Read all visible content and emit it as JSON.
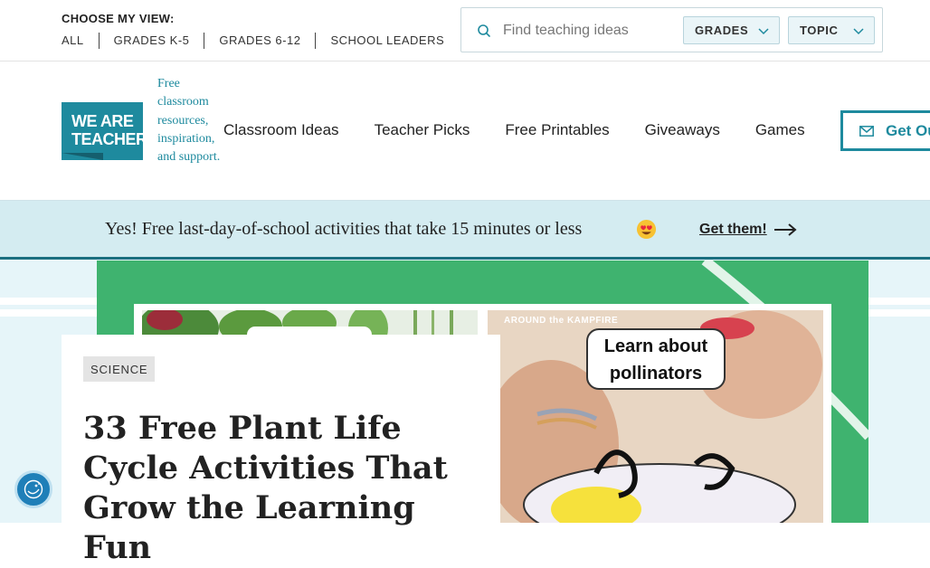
{
  "topbar": {
    "view_title": "CHOOSE MY VIEW:",
    "view_links": [
      "ALL",
      "GRADES K-5",
      "GRADES 6-12",
      "SCHOOL LEADERS"
    ],
    "search_placeholder": "Find teaching ideas",
    "filters": [
      "GRADES",
      "TOPIC"
    ]
  },
  "header": {
    "logo_text": "WE ARE TEACHERS",
    "tagline": "Free classroom resources, inspiration, and support.",
    "nav": [
      "Classroom Ideas",
      "Teacher Picks",
      "Free Printables",
      "Giveaways",
      "Games"
    ],
    "cta_label": "Get Ou"
  },
  "banner": {
    "text": "Yes! Free last-day-of-school activities that take 15 minutes or less",
    "link_label": "Get them!",
    "bg_color": "#d4ecf1"
  },
  "hero": {
    "photo_brand": "AROUND the KAMPFIRE",
    "photo_caption": "Learn about pollinators",
    "accent_color": "#3fb36f"
  },
  "article": {
    "category": "SCIENCE",
    "title": "33 Free Plant Life Cycle Activities That Grow the Learning Fun"
  },
  "brand_color": "#1e8a9e"
}
